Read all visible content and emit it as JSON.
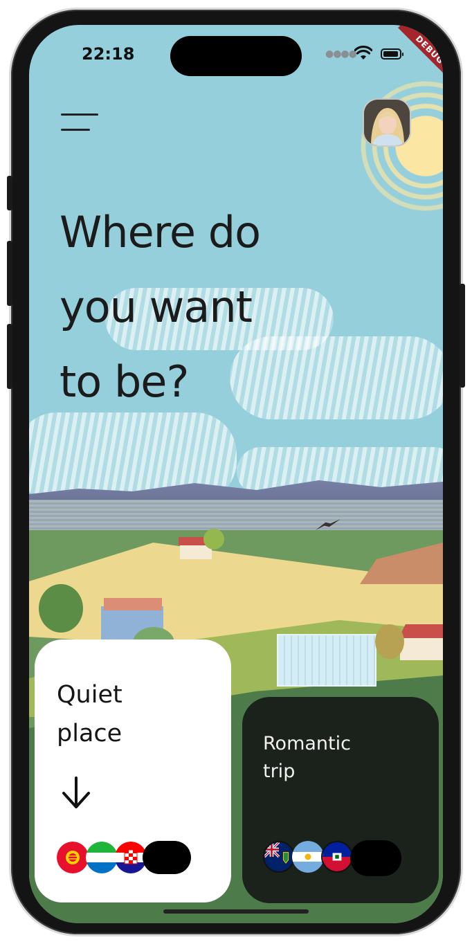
{
  "status_bar": {
    "time": "22:18",
    "debug_label": "DEBUG"
  },
  "header": {
    "menu_icon": "hamburger-menu-icon",
    "avatar_icon": "user-avatar"
  },
  "hero": {
    "title_lines": [
      "Where do",
      "you want",
      "to be?"
    ]
  },
  "cards": [
    {
      "title_lines": [
        "Quiet",
        "place"
      ],
      "icon": "arrow-down-icon",
      "flags": [
        "kyrgyzstan-flag",
        "sierra-leone-flag",
        "croatia-flag"
      ],
      "style": "light"
    },
    {
      "title_lines": [
        "Romantic",
        "trip"
      ],
      "flags": [
        "pitcairn-islands-flag",
        "argentina-flag",
        "haiti-flag"
      ],
      "style": "dark"
    }
  ],
  "colors": {
    "sky": "#94cfdb",
    "card_light_bg": "#ffffff",
    "card_dark_bg": "#141414",
    "text_dark": "#1b1b1b",
    "debug_ribbon": "#a4262c"
  }
}
